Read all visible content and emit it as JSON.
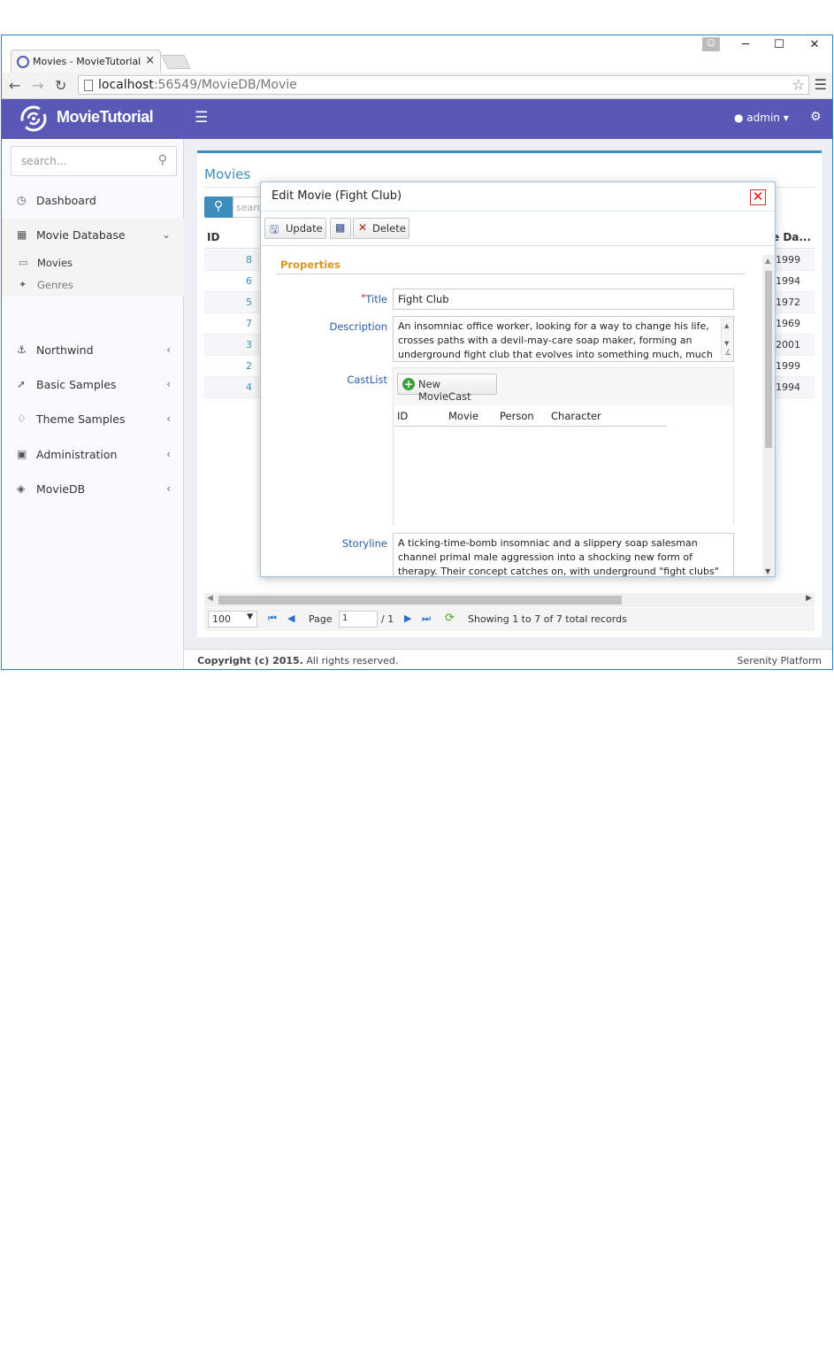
{
  "browser": {
    "tab_title": "Movies - MovieTutorial",
    "tab_close": "×",
    "url_host": "localhost",
    "url_path": ":56549/MovieDB/Movie",
    "buttons": {
      "minimize": "─",
      "maximize": "☐",
      "close": "✕"
    }
  },
  "header": {
    "app_name": "MovieTutorial",
    "user": "admin"
  },
  "sidebar": {
    "search_placeholder": "search...",
    "items": [
      {
        "label": "Dashboard",
        "icon": "dashboard-icon"
      },
      {
        "label": "Movie Database",
        "icon": "film-icon",
        "expanded": true
      },
      {
        "label": "Northwind",
        "icon": "anchor-icon"
      },
      {
        "label": "Basic Samples",
        "icon": "magic-icon"
      },
      {
        "label": "Theme Samples",
        "icon": "diamond-icon"
      },
      {
        "label": "Administration",
        "icon": "monitor-icon"
      },
      {
        "label": "MovieDB",
        "icon": "layers-icon"
      }
    ],
    "sub_items": [
      {
        "label": "Movies",
        "icon": "video-icon"
      },
      {
        "label": "Genres",
        "icon": "pin-icon"
      }
    ]
  },
  "page": {
    "title": "Movies",
    "search_placeholder": "search",
    "grid_headers": {
      "id": "ID",
      "release_date": "e Da..."
    },
    "rows": [
      {
        "id": "8",
        "year": "1999"
      },
      {
        "id": "6",
        "year": "1994"
      },
      {
        "id": "5",
        "year": "1972"
      },
      {
        "id": "7",
        "year": "1969"
      },
      {
        "id": "3",
        "year": "2001"
      },
      {
        "id": "2",
        "year": "1999"
      },
      {
        "id": "4",
        "year": "1994"
      }
    ],
    "pager": {
      "page_size": "100",
      "page_label": "Page",
      "page_value": "1",
      "page_total": "/ 1",
      "status": "Showing 1 to 7 of 7 total records"
    }
  },
  "footer": {
    "copyright_bold": "Copyright (c) 2015.",
    "copyright_rest": " All rights reserved.",
    "brand": "Serenity Platform"
  },
  "dialog": {
    "title": "Edit Movie (Fight Club)",
    "toolbar": {
      "update": "Update",
      "delete": "Delete"
    },
    "category": "Properties",
    "fields": {
      "title_label": "Title",
      "title_required_mark": "*",
      "title_value": "Fight Club",
      "description_label": "Description",
      "description_value": "An insomniac office worker, looking for a way to change his life, crosses paths with a devil-may-care soap maker, forming an underground fight club that evolves into something much, much",
      "castlist_label": "CastList",
      "new_moviecast": "New MovieCast",
      "cast_columns": [
        "ID",
        "Movie",
        "Person",
        "Character"
      ],
      "storyline_label": "Storyline",
      "storyline_value": "A ticking-time-bomb insomniac and a slippery soap salesman channel primal male aggression into a shocking new form of therapy. Their concept catches on, with underground \"fight clubs\" forming in every"
    }
  },
  "colors": {
    "header_bg": "#5a58b5",
    "accent_blue": "#3c8dbc",
    "category_orange": "#d59b1e",
    "label_blue": "#2a5ca5"
  }
}
